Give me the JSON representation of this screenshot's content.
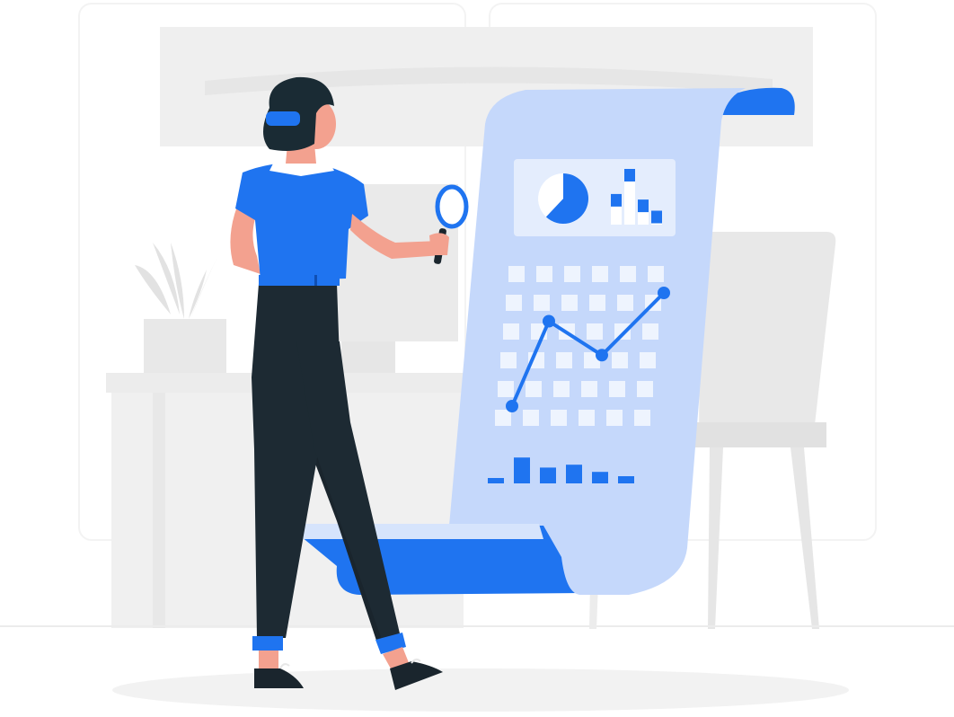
{
  "illustration": {
    "subject": "analyst-with-magnifier",
    "icons": [
      "magnifying-glass-icon",
      "pie-chart-icon",
      "bar-chart-icon",
      "line-chart-icon"
    ]
  },
  "colors": {
    "accent": "#1f74f0",
    "scroll": "#c5d8fb",
    "panel_light": "#e4edfd",
    "tile": "#eef4fe",
    "background_shape": "#efefef",
    "background_shape_dark": "#e6e6e6",
    "pants": "#1d2a33",
    "skin": "#f3a18f",
    "hair": "#1a2b34"
  },
  "mini_charts": {
    "pie": {
      "type": "pie",
      "values": [
        0.62,
        0.38
      ]
    },
    "top_bars": {
      "type": "bar",
      "values": [
        0.55,
        1.0,
        0.45,
        0.25
      ]
    },
    "line": {
      "type": "line",
      "values": [
        0.0,
        0.75,
        0.45,
        1.0
      ]
    },
    "bottom_bars": {
      "type": "bar",
      "values": [
        0.15,
        0.9,
        0.55,
        0.65,
        0.4,
        0.25
      ]
    }
  }
}
